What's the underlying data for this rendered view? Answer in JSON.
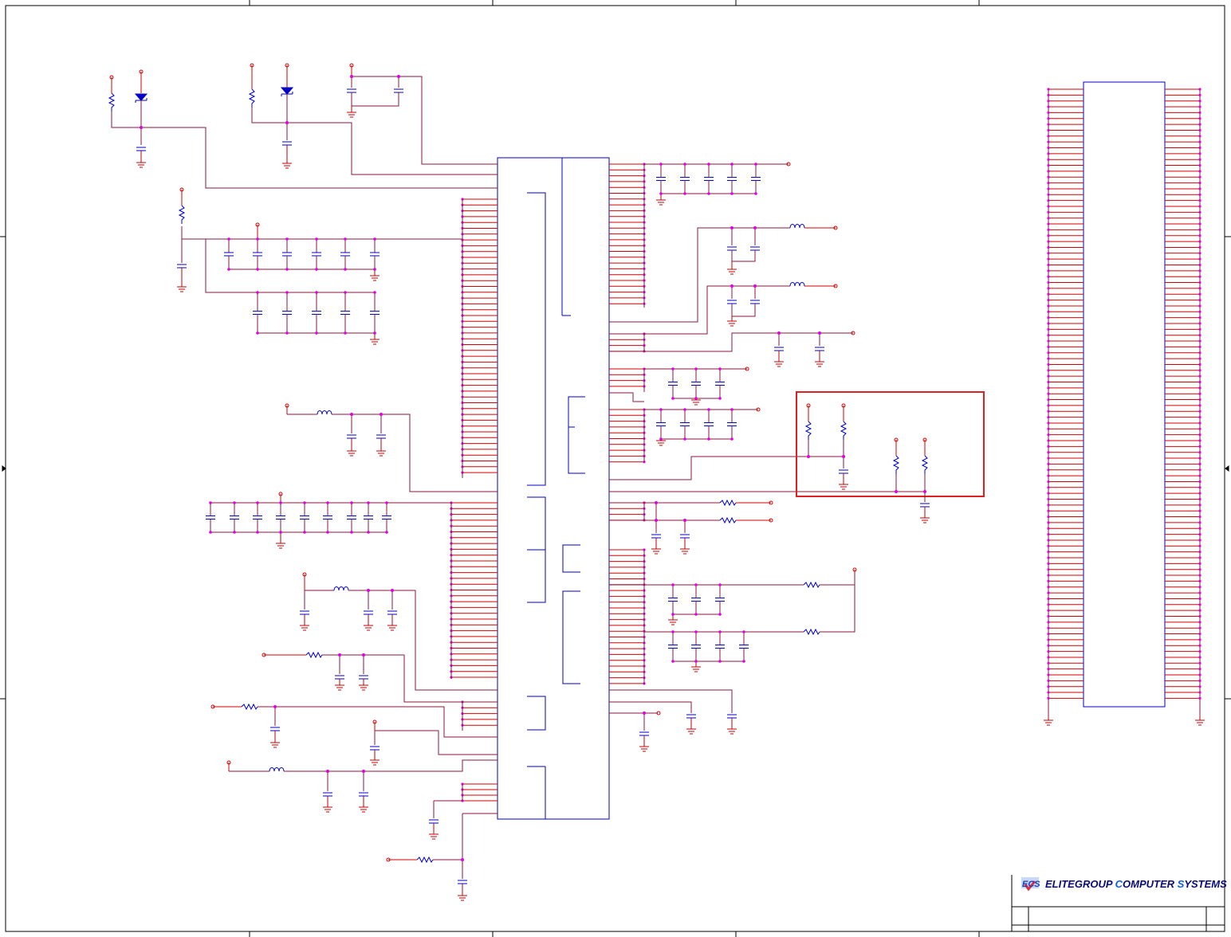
{
  "company": {
    "logo_text": "ECS",
    "name_parts": [
      {
        "text": "ELITEGROUP ",
        "color": "#0a0a7a"
      },
      {
        "text": "C",
        "color": "#1060e0"
      },
      {
        "text": "OMPUTER ",
        "color": "#0a0a7a"
      },
      {
        "text": "S",
        "color": "#1060e0"
      },
      {
        "text": "YSTEMS",
        "color": "#0a0a7a"
      }
    ]
  },
  "colors": {
    "wire": "#8b1a3c",
    "net_stub": "#d40000",
    "component": "#0000c8",
    "node": "#e000e0",
    "highlight": "#e02020",
    "frame": "#000000"
  },
  "highlight_box": {
    "label": ""
  }
}
